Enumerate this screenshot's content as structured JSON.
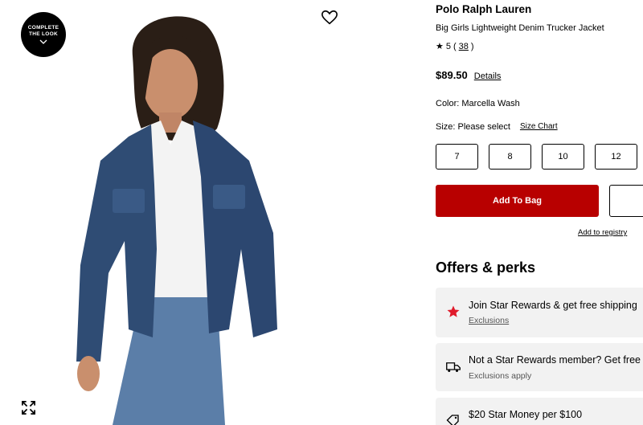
{
  "gallery": {
    "badge_line1": "COMPLETE",
    "badge_line2": "THE LOOK",
    "icons": [
      "heart-icon",
      "expand-icon",
      "chevron-down-icon"
    ]
  },
  "product": {
    "brand": "Polo Ralph Lauren",
    "name": "Big Girls Lightweight Denim Trucker Jacket",
    "rating": "5",
    "review_count": "38",
    "price": "$89.50",
    "details_label": "Details",
    "color_label": "Color: Marcella Wash",
    "size_label": "Size: Please select",
    "size_chart_label": "Size Chart",
    "sizes": [
      "7",
      "8",
      "10",
      "12"
    ],
    "add_to_bag_label": "Add To Bag",
    "add_to_registry_label": "Add to registry"
  },
  "offers": {
    "title": "Offers & perks",
    "items": [
      {
        "title": "Join Star Rewards & get free shipping",
        "subtitle": "Exclusions",
        "icon": "star-icon"
      },
      {
        "title": "Not a Star Rewards member? Get free shipping",
        "subtitle": "Exclusions apply",
        "icon": "truck-icon"
      },
      {
        "title": "$20 Star Money per $100",
        "subtitle": "",
        "icon": "tag-icon"
      }
    ]
  },
  "colors": {
    "accent_red": "#b80000",
    "star_red": "#e01a2b",
    "offer_bg": "#f2f2f2"
  }
}
